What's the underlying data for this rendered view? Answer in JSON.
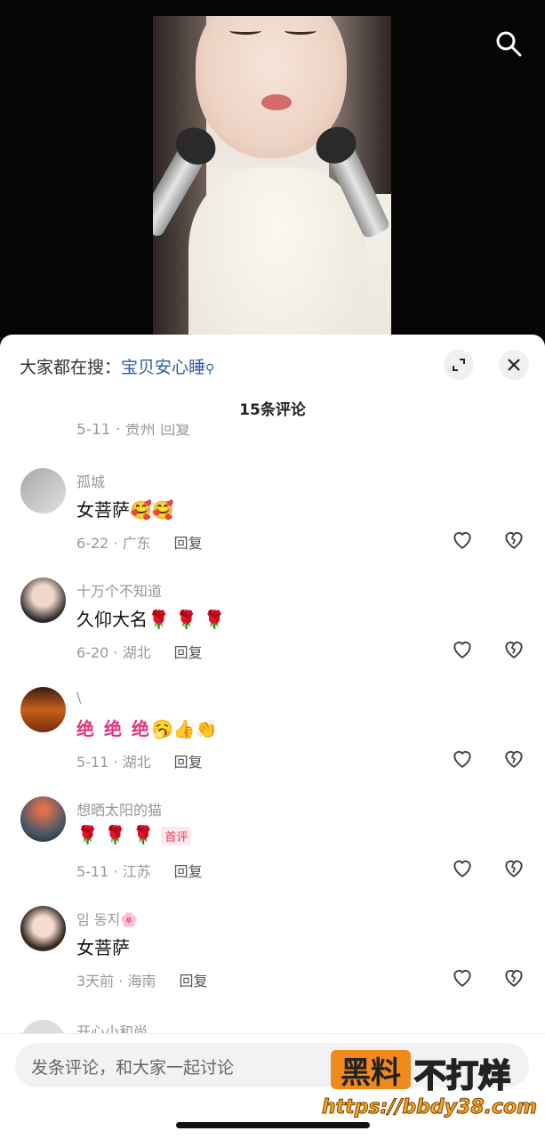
{
  "hot_search": {
    "prefix": "大家都在搜：",
    "keyword": "宝贝安心睡"
  },
  "comment_count": "15条评论",
  "partial_top_meta": "5-11 · 贵州   回复",
  "comments": [
    {
      "name": "孤城",
      "text": "女菩萨🥰🥰",
      "date": "6-22",
      "location": "广东",
      "reply": "回复"
    },
    {
      "name": "十万个不知道",
      "text": "久仰大名🌹 🌹 🌹",
      "date": "6-20",
      "location": "湖北",
      "reply": "回复"
    },
    {
      "name": "\\",
      "text_big": "绝 绝 绝",
      "text": "🥱👍👏",
      "date": "5-11",
      "location": "湖北",
      "reply": "回复"
    },
    {
      "name": "想晒太阳的猫",
      "text": "🌹 🌹 🌹",
      "badge": "首评",
      "date": "5-11",
      "location": "江苏",
      "reply": "回复"
    },
    {
      "name": "임 동지🌸",
      "text": "女菩萨",
      "date": "3天前",
      "location": "海南",
      "reply": "回复"
    }
  ],
  "partial_bottom_name": "开心小和尚",
  "input": {
    "placeholder": "发条评论，和大家一起讨论"
  },
  "watermark": {
    "box": "黑料",
    "side": "不打烊",
    "url": "https://bbdy38.com"
  },
  "colors": {
    "accent": "#2a5ca8",
    "badge": "#e8405a"
  }
}
